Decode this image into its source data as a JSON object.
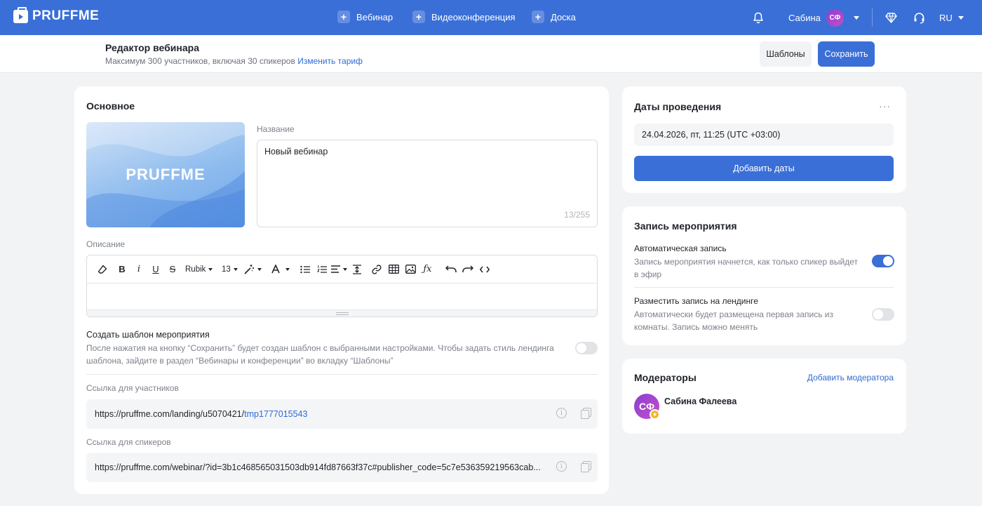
{
  "app": {
    "logo": "PRUFFME"
  },
  "topnav": [
    {
      "label": "Вебинар"
    },
    {
      "label": "Видеоконференция"
    },
    {
      "label": "Доска"
    }
  ],
  "user": {
    "name": "Сабина",
    "initials": "СФ",
    "lang": "RU"
  },
  "subheader": {
    "title": "Редактор вебинара",
    "limits": "Максимум 300 участников, включая 30 спикеров",
    "change_plan": "Изменить тариф",
    "templates_btn": "Шаблоны",
    "save_btn": "Сохранить"
  },
  "main": {
    "title": "Основное",
    "cover_text": "PRUFFME",
    "name_label": "Название",
    "name_value": "Новый вебинар",
    "name_counter": "13/255",
    "desc_label": "Описание",
    "editor": {
      "font": "Rubik",
      "size": "13"
    },
    "template": {
      "title": "Создать шаблон мероприятия",
      "desc": "После нажатия на кнопку “Сохранить” будет создан шаблон с выбранными настройками. Чтобы задать стиль лендинга шаблона, зайдите в раздел “Вебинары и конференции” во вкладку “Шаблоны”",
      "enabled": false
    },
    "participants_link_label": "Ссылка для участников",
    "participants_link_prefix": "https://pruffme.com/landing/u5070421/",
    "participants_link_suffix": "tmp1777015543",
    "speakers_link_label": "Ссылка для спикеров",
    "speakers_link": "https://pruffme.com/webinar/?id=3b1c468565031503db914fd87663f37c#publisher_code=5c7e536359219563cab..."
  },
  "dates": {
    "title": "Даты проведения",
    "value": "24.04.2026, пт, 11:25 (UTC +03:00)",
    "add_btn": "Добавить даты"
  },
  "recording": {
    "title": "Запись мероприятия",
    "auto_title": "Автоматическая запись",
    "auto_desc_1": "Запись мероприятия начнется, как только спикер выйдет",
    "auto_desc_2": "в эфир",
    "auto_enabled": true,
    "landing_title": "Разместить запись на лендинге",
    "landing_desc_1": "Автоматически будет размещена первая запись из",
    "landing_desc_2": "комнаты. Запись можно менять",
    "landing_enabled": false
  },
  "moderators": {
    "title": "Модераторы",
    "add_link": "Добавить модератора",
    "items": [
      {
        "name": "Сабина Фалеева",
        "initials": "СФ"
      }
    ]
  },
  "colors": {
    "accent": "#3a6fd8",
    "link": "#2e6bd6",
    "bg": "#f2f3f5"
  }
}
